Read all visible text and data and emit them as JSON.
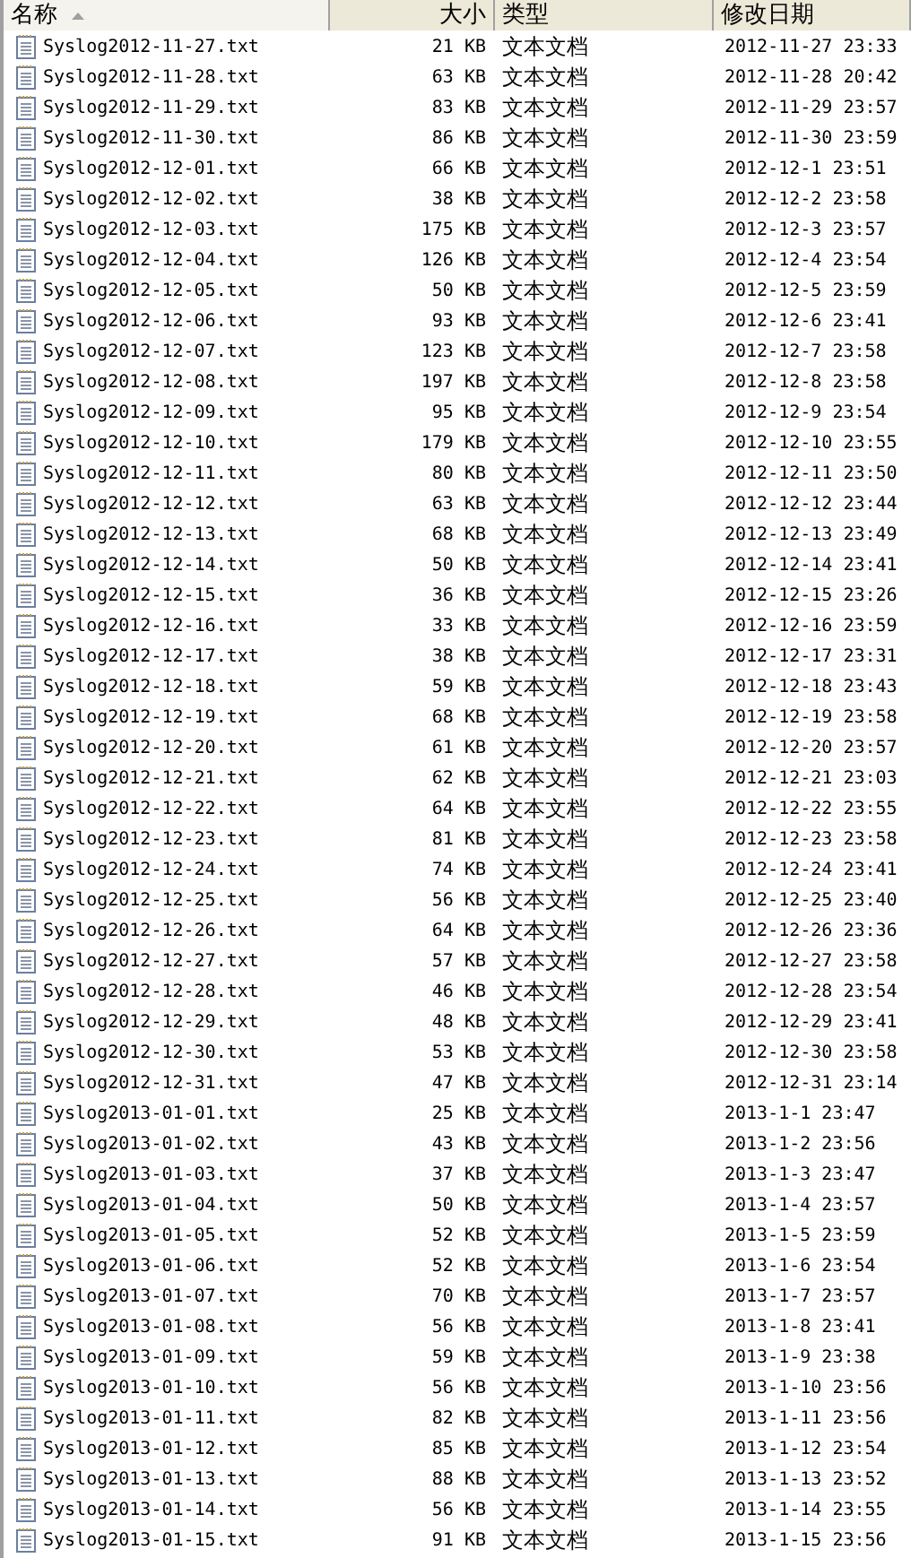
{
  "columns": [
    {
      "label": "名称",
      "sorted": true
    },
    {
      "label": "大小",
      "sorted": false
    },
    {
      "label": "类型",
      "sorted": false
    },
    {
      "label": "修改日期",
      "sorted": false
    }
  ],
  "rows": [
    {
      "name": "Syslog2012-11-27.txt",
      "size": "21 KB",
      "type": "文本文档",
      "modified": "2012-11-27 23:33"
    },
    {
      "name": "Syslog2012-11-28.txt",
      "size": "63 KB",
      "type": "文本文档",
      "modified": "2012-11-28 20:42"
    },
    {
      "name": "Syslog2012-11-29.txt",
      "size": "83 KB",
      "type": "文本文档",
      "modified": "2012-11-29 23:57"
    },
    {
      "name": "Syslog2012-11-30.txt",
      "size": "86 KB",
      "type": "文本文档",
      "modified": "2012-11-30 23:59"
    },
    {
      "name": "Syslog2012-12-01.txt",
      "size": "66 KB",
      "type": "文本文档",
      "modified": "2012-12-1 23:51"
    },
    {
      "name": "Syslog2012-12-02.txt",
      "size": "38 KB",
      "type": "文本文档",
      "modified": "2012-12-2 23:58"
    },
    {
      "name": "Syslog2012-12-03.txt",
      "size": "175 KB",
      "type": "文本文档",
      "modified": "2012-12-3 23:57"
    },
    {
      "name": "Syslog2012-12-04.txt",
      "size": "126 KB",
      "type": "文本文档",
      "modified": "2012-12-4 23:54"
    },
    {
      "name": "Syslog2012-12-05.txt",
      "size": "50 KB",
      "type": "文本文档",
      "modified": "2012-12-5 23:59"
    },
    {
      "name": "Syslog2012-12-06.txt",
      "size": "93 KB",
      "type": "文本文档",
      "modified": "2012-12-6 23:41"
    },
    {
      "name": "Syslog2012-12-07.txt",
      "size": "123 KB",
      "type": "文本文档",
      "modified": "2012-12-7 23:58"
    },
    {
      "name": "Syslog2012-12-08.txt",
      "size": "197 KB",
      "type": "文本文档",
      "modified": "2012-12-8 23:58"
    },
    {
      "name": "Syslog2012-12-09.txt",
      "size": "95 KB",
      "type": "文本文档",
      "modified": "2012-12-9 23:54"
    },
    {
      "name": "Syslog2012-12-10.txt",
      "size": "179 KB",
      "type": "文本文档",
      "modified": "2012-12-10 23:55"
    },
    {
      "name": "Syslog2012-12-11.txt",
      "size": "80 KB",
      "type": "文本文档",
      "modified": "2012-12-11 23:50"
    },
    {
      "name": "Syslog2012-12-12.txt",
      "size": "63 KB",
      "type": "文本文档",
      "modified": "2012-12-12 23:44"
    },
    {
      "name": "Syslog2012-12-13.txt",
      "size": "68 KB",
      "type": "文本文档",
      "modified": "2012-12-13 23:49"
    },
    {
      "name": "Syslog2012-12-14.txt",
      "size": "50 KB",
      "type": "文本文档",
      "modified": "2012-12-14 23:41"
    },
    {
      "name": "Syslog2012-12-15.txt",
      "size": "36 KB",
      "type": "文本文档",
      "modified": "2012-12-15 23:26"
    },
    {
      "name": "Syslog2012-12-16.txt",
      "size": "33 KB",
      "type": "文本文档",
      "modified": "2012-12-16 23:59"
    },
    {
      "name": "Syslog2012-12-17.txt",
      "size": "38 KB",
      "type": "文本文档",
      "modified": "2012-12-17 23:31"
    },
    {
      "name": "Syslog2012-12-18.txt",
      "size": "59 KB",
      "type": "文本文档",
      "modified": "2012-12-18 23:43"
    },
    {
      "name": "Syslog2012-12-19.txt",
      "size": "68 KB",
      "type": "文本文档",
      "modified": "2012-12-19 23:58"
    },
    {
      "name": "Syslog2012-12-20.txt",
      "size": "61 KB",
      "type": "文本文档",
      "modified": "2012-12-20 23:57"
    },
    {
      "name": "Syslog2012-12-21.txt",
      "size": "62 KB",
      "type": "文本文档",
      "modified": "2012-12-21 23:03"
    },
    {
      "name": "Syslog2012-12-22.txt",
      "size": "64 KB",
      "type": "文本文档",
      "modified": "2012-12-22 23:55"
    },
    {
      "name": "Syslog2012-12-23.txt",
      "size": "81 KB",
      "type": "文本文档",
      "modified": "2012-12-23 23:58"
    },
    {
      "name": "Syslog2012-12-24.txt",
      "size": "74 KB",
      "type": "文本文档",
      "modified": "2012-12-24 23:41"
    },
    {
      "name": "Syslog2012-12-25.txt",
      "size": "56 KB",
      "type": "文本文档",
      "modified": "2012-12-25 23:40"
    },
    {
      "name": "Syslog2012-12-26.txt",
      "size": "64 KB",
      "type": "文本文档",
      "modified": "2012-12-26 23:36"
    },
    {
      "name": "Syslog2012-12-27.txt",
      "size": "57 KB",
      "type": "文本文档",
      "modified": "2012-12-27 23:58"
    },
    {
      "name": "Syslog2012-12-28.txt",
      "size": "46 KB",
      "type": "文本文档",
      "modified": "2012-12-28 23:54"
    },
    {
      "name": "Syslog2012-12-29.txt",
      "size": "48 KB",
      "type": "文本文档",
      "modified": "2012-12-29 23:41"
    },
    {
      "name": "Syslog2012-12-30.txt",
      "size": "53 KB",
      "type": "文本文档",
      "modified": "2012-12-30 23:58"
    },
    {
      "name": "Syslog2012-12-31.txt",
      "size": "47 KB",
      "type": "文本文档",
      "modified": "2012-12-31 23:14"
    },
    {
      "name": "Syslog2013-01-01.txt",
      "size": "25 KB",
      "type": "文本文档",
      "modified": "2013-1-1 23:47"
    },
    {
      "name": "Syslog2013-01-02.txt",
      "size": "43 KB",
      "type": "文本文档",
      "modified": "2013-1-2 23:56"
    },
    {
      "name": "Syslog2013-01-03.txt",
      "size": "37 KB",
      "type": "文本文档",
      "modified": "2013-1-3 23:47"
    },
    {
      "name": "Syslog2013-01-04.txt",
      "size": "50 KB",
      "type": "文本文档",
      "modified": "2013-1-4 23:57"
    },
    {
      "name": "Syslog2013-01-05.txt",
      "size": "52 KB",
      "type": "文本文档",
      "modified": "2013-1-5 23:59"
    },
    {
      "name": "Syslog2013-01-06.txt",
      "size": "52 KB",
      "type": "文本文档",
      "modified": "2013-1-6 23:54"
    },
    {
      "name": "Syslog2013-01-07.txt",
      "size": "70 KB",
      "type": "文本文档",
      "modified": "2013-1-7 23:57"
    },
    {
      "name": "Syslog2013-01-08.txt",
      "size": "56 KB",
      "type": "文本文档",
      "modified": "2013-1-8 23:41"
    },
    {
      "name": "Syslog2013-01-09.txt",
      "size": "59 KB",
      "type": "文本文档",
      "modified": "2013-1-9 23:38"
    },
    {
      "name": "Syslog2013-01-10.txt",
      "size": "56 KB",
      "type": "文本文档",
      "modified": "2013-1-10 23:56"
    },
    {
      "name": "Syslog2013-01-11.txt",
      "size": "82 KB",
      "type": "文本文档",
      "modified": "2013-1-11 23:56"
    },
    {
      "name": "Syslog2013-01-12.txt",
      "size": "85 KB",
      "type": "文本文档",
      "modified": "2013-1-12 23:54"
    },
    {
      "name": "Syslog2013-01-13.txt",
      "size": "88 KB",
      "type": "文本文档",
      "modified": "2013-1-13 23:52"
    },
    {
      "name": "Syslog2013-01-14.txt",
      "size": "56 KB",
      "type": "文本文档",
      "modified": "2013-1-14 23:55"
    },
    {
      "name": "Syslog2013-01-15.txt",
      "size": "91 KB",
      "type": "文本文档",
      "modified": "2013-1-15 23:56"
    }
  ]
}
